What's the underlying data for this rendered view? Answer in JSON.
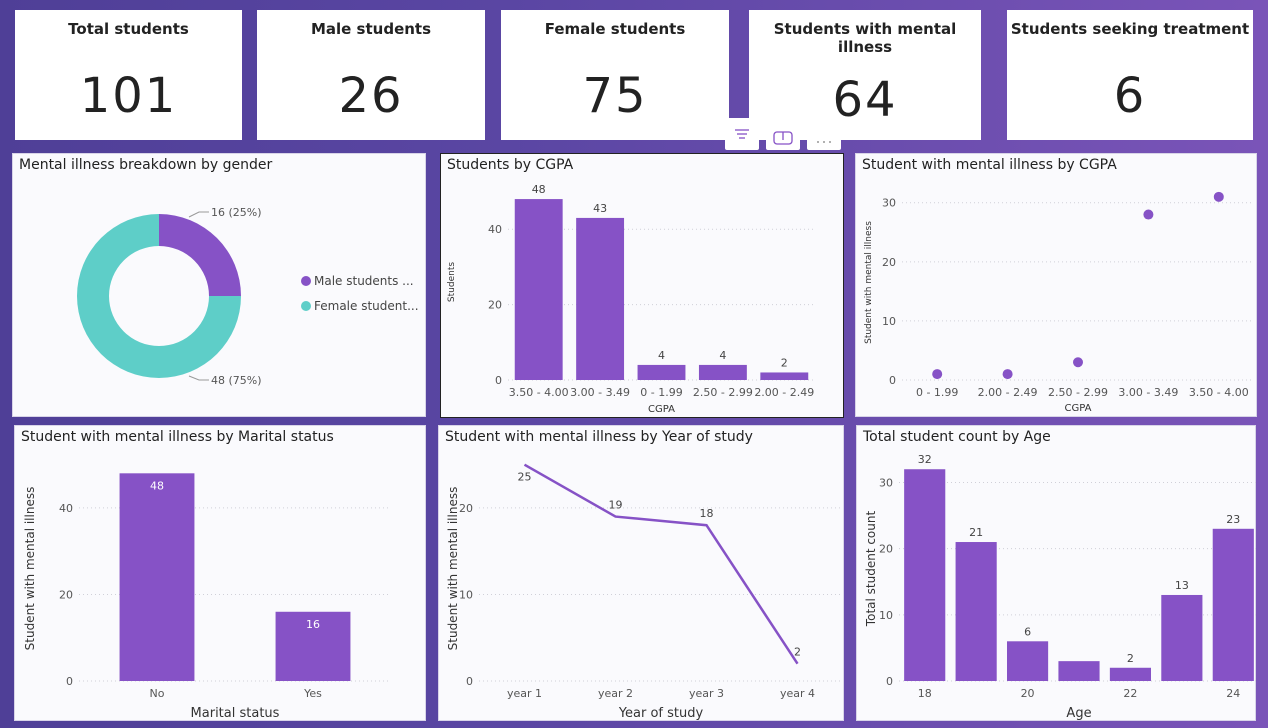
{
  "colors": {
    "purple": "#8652c6",
    "teal": "#5ecec8",
    "grid": "#d0d0d8",
    "axis_text": "#555"
  },
  "kpis": [
    {
      "label": "Total students",
      "value": "101"
    },
    {
      "label": "Male students",
      "value": "26"
    },
    {
      "label": "Female students",
      "value": "75"
    },
    {
      "label": "Students with mental illness",
      "value": "64"
    },
    {
      "label": "Students seeking treatment",
      "value": "6"
    }
  ],
  "visual_header_icons": [
    "filter-icon",
    "focus-mode-icon",
    "more-options-icon"
  ],
  "chart_data": [
    {
      "type": "donut",
      "title": "Mental illness breakdown by gender",
      "slices": [
        {
          "label": "Male students ...",
          "value": 16,
          "data_label": "16 (25%)",
          "color": "#8652c6"
        },
        {
          "label": "Female student...",
          "value": 48,
          "data_label": "48 (75%)",
          "color": "#5ecec8"
        }
      ],
      "legend_position": "right"
    },
    {
      "type": "bar",
      "title": "Students by CGPA",
      "categories": [
        "3.50 - 4.00",
        "3.00 - 3.49",
        "0 - 1.99",
        "2.50 - 2.99",
        "2.00 - 2.49"
      ],
      "values": [
        48,
        43,
        4,
        4,
        2
      ],
      "xlabel": "CGPA",
      "ylabel": "Students",
      "ylim": [
        0,
        52
      ],
      "yticks": [
        0,
        20,
        40
      ]
    },
    {
      "type": "scatter",
      "title": "Student with mental illness by CGPA",
      "categories": [
        "0 - 1.99",
        "2.00 - 2.49",
        "2.50 - 2.99",
        "3.00 - 3.49",
        "3.50 - 4.00"
      ],
      "values": [
        1,
        1,
        3,
        28,
        31
      ],
      "xlabel": "CGPA",
      "ylabel": "Student with mental illness",
      "ylim": [
        0,
        33
      ],
      "yticks": [
        0,
        10,
        20,
        30
      ]
    },
    {
      "type": "bar",
      "title": "Student with mental illness by Marital status",
      "categories": [
        "No",
        "Yes"
      ],
      "values": [
        48,
        16
      ],
      "xlabel": "Marital status",
      "ylabel": "Student with mental illness",
      "ylim": [
        0,
        52
      ],
      "yticks": [
        0,
        20,
        40
      ],
      "labels_inside": true
    },
    {
      "type": "line",
      "title": "Student with mental illness by Year of study",
      "categories": [
        "year 1",
        "year 2",
        "year 3",
        "year 4"
      ],
      "values": [
        25,
        19,
        18,
        2
      ],
      "xlabel": "Year of study",
      "ylabel": "Student with mental illness",
      "ylim": [
        0,
        26
      ],
      "yticks": [
        0,
        10,
        20
      ]
    },
    {
      "type": "bar",
      "title": "Total student count by Age",
      "x": [
        18,
        19,
        20,
        21,
        22,
        23,
        24
      ],
      "values": [
        32,
        21,
        6,
        3,
        2,
        13,
        23
      ],
      "data_labels": [
        "32",
        "21",
        "6",
        "",
        "2",
        "13",
        "23"
      ],
      "xticks": [
        "18",
        "",
        "20",
        "",
        "22",
        "",
        "24"
      ],
      "xlabel": "Age",
      "ylabel": "Total student count",
      "ylim": [
        0,
        34
      ],
      "yticks": [
        0,
        10,
        20,
        30
      ]
    }
  ]
}
